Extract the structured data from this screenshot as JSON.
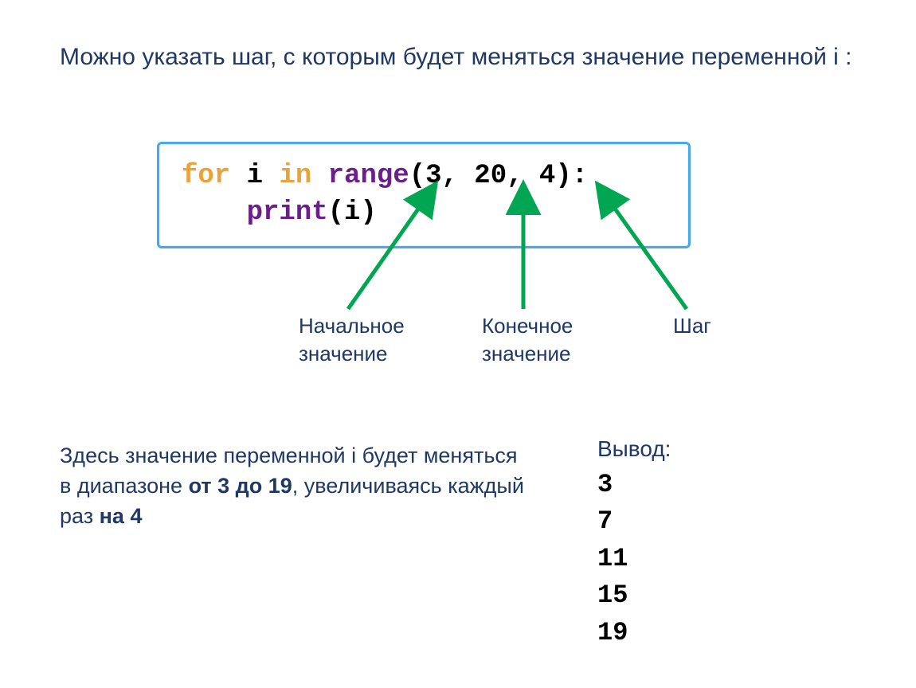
{
  "intro": "Можно указать шаг, с которым будет меняться значение переменной i :",
  "code": {
    "kw_for": "for",
    "var_i": " i ",
    "kw_in": "in",
    "sp": " ",
    "fn_range": "range",
    "args": "(3, 20, 4):",
    "indent": "    ",
    "fn_print": "print",
    "print_arg": "(i)"
  },
  "labels": {
    "start": "Начальное\nзначение",
    "end": "Конечное\nзначение",
    "step": "Шаг"
  },
  "explain": {
    "t1": "Здесь значение переменной i будет меняться в диапазоне ",
    "b1": "от 3 до 19",
    "t2": ", увеличиваясь каждый раз ",
    "b2": "на 4"
  },
  "output": {
    "title": "Вывод:",
    "values": [
      "3",
      "7",
      "11",
      "15",
      "19"
    ]
  },
  "colors": {
    "text": "#1F3864",
    "arrow": "#00A651",
    "border": "#4BA8E8"
  }
}
